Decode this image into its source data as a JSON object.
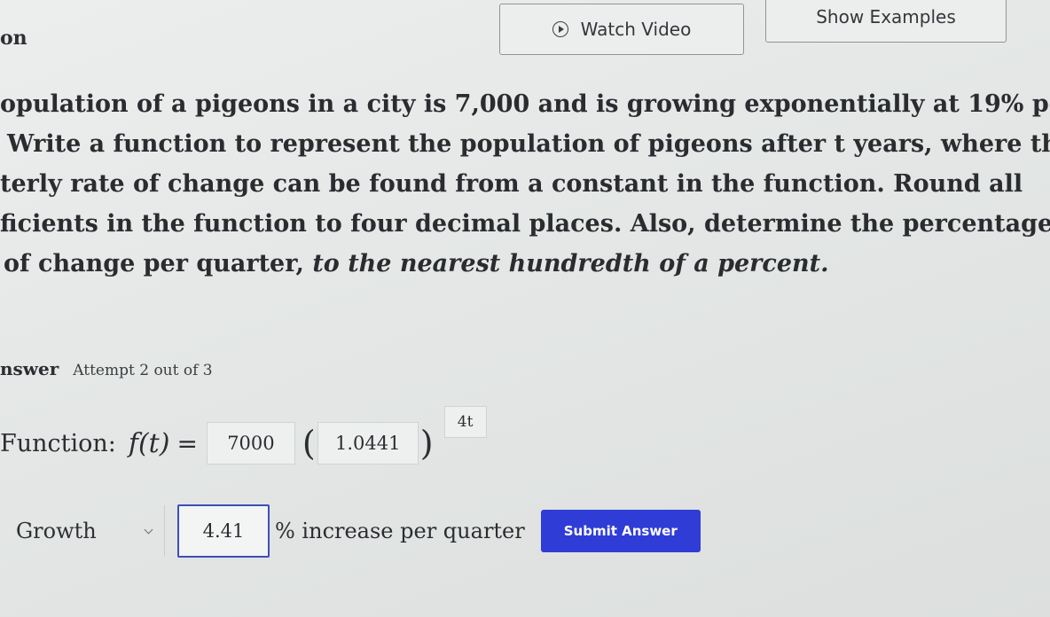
{
  "header": {
    "title_fragment": "on",
    "watch_video_label": "Watch Video",
    "show_examples_label": "Show Examples"
  },
  "problem": {
    "lines": [
      "opulation of a pigeons in a city is 7,000 and is growing exponentially at 19% per",
      "Write a function to represent the population of pigeons after t years, where the",
      "terly rate of change can be found from a constant in the function. Round all",
      "ficients in the function to four decimal places. Also, determine the percentage",
      "of change per quarter, "
    ],
    "emphasis": "to the nearest hundredth of a percent."
  },
  "answer": {
    "label": "nswer",
    "attempt": "Attempt 2 out of 3"
  },
  "function": {
    "label": "Function:",
    "expr": "f(t)",
    "equals": "=",
    "coefficient": "7000",
    "base": "1.0441",
    "exponent": "4t",
    "open_paren": "(",
    "close_paren": ")"
  },
  "growth": {
    "selected": "Growth",
    "value": "4.41",
    "suffix": "% increase per quarter",
    "submit_label": "Submit Answer"
  }
}
